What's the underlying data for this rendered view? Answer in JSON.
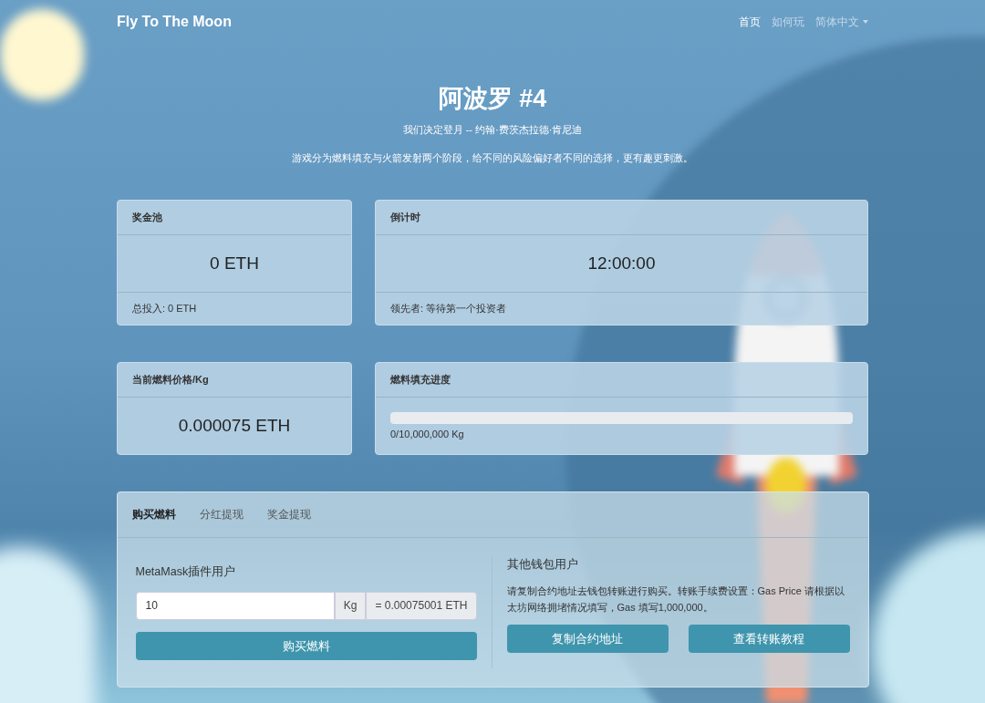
{
  "brand": "Fly To The Moon",
  "nav": [
    {
      "label": "首页",
      "selected": true,
      "kind": "link"
    },
    {
      "label": "如何玩",
      "selected": false,
      "kind": "link"
    },
    {
      "label": "简体中文",
      "selected": false,
      "kind": "dropdown"
    }
  ],
  "hero": {
    "title": "阿波罗 #4",
    "quote": "我们决定登月 -- 约翰·费茨杰拉德·肯尼迪",
    "description": "游戏分为燃料填充与火箭发射两个阶段，给不同的风险偏好者不同的选择，更有趣更刺激。"
  },
  "cards": [
    {
      "kind": "stat",
      "header": "奖金池",
      "value": "0 ETH",
      "footer": "总投入: 0 ETH"
    },
    {
      "kind": "stat",
      "header": "倒计时",
      "value": "12:00:00",
      "footer": "领先者: 等待第一个投资者"
    },
    {
      "kind": "stat",
      "header": "当前燃料价格/Kg",
      "value": "0.000075 ETH"
    },
    {
      "kind": "progress",
      "header": "燃料填充进度",
      "level": 0,
      "caption": "0/10,000,000 Kg"
    }
  ],
  "panel": {
    "tabs": [
      {
        "label": "购买燃料",
        "selected": true
      },
      {
        "label": "分红提现",
        "selected": false
      },
      {
        "label": "奖金提现",
        "selected": false
      }
    ],
    "metamask": {
      "title": "MetaMask插件用户",
      "amount": "10",
      "unit": "Kg",
      "equivalent": "= 0.00075001 ETH",
      "button": "购买燃料"
    },
    "other_wallet": {
      "title": "其他钱包用户",
      "instructions": "请复制合约地址去钱包转账进行购买。转账手续费设置：Gas Price 请根据以太坊网络拥堵情况填写，Gas 填写1,000,000。",
      "buttons": [
        "复制合约地址",
        "查看转账教程"
      ]
    }
  }
}
